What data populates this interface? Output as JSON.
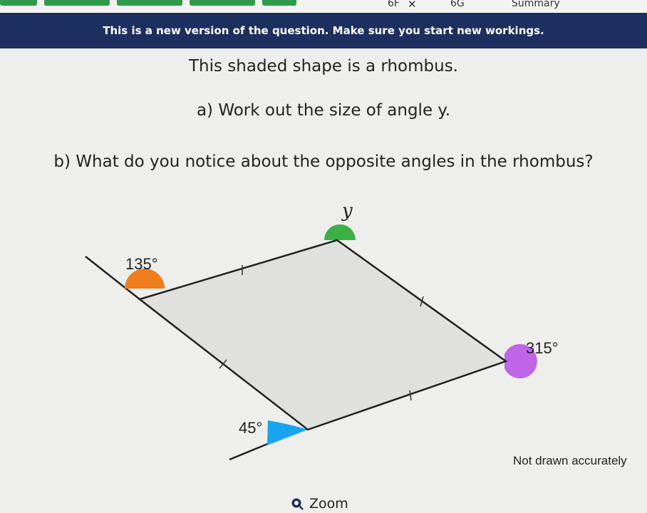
{
  "top_bar": {
    "tabs": [
      "6F",
      "6G",
      "Summary"
    ],
    "close_symbol": "✕"
  },
  "banner": {
    "text": "This is a new version of the question. Make sure you start new workings."
  },
  "question": {
    "intro": "This shaded shape is a rhombus.",
    "part_a": "a) Work out the size of angle y.",
    "part_b": "b) What do you notice about the opposite angles in the rhombus?"
  },
  "diagram": {
    "angle_top_label": "y",
    "angle_left_label": "135°",
    "angle_right_label": "315°",
    "angle_bottom_label": "45°",
    "note": "Not drawn accurately",
    "colors": {
      "shape_fill": "#e0e0de",
      "angle_top": "#3cb044",
      "angle_left": "#f07e1e",
      "angle_right": "#c064e8",
      "angle_bottom": "#1aa4ee"
    }
  },
  "zoom": {
    "label": "Zoom"
  },
  "colors": {
    "banner_bg": "#1d2f5e",
    "progress": "#2f9b4a"
  }
}
